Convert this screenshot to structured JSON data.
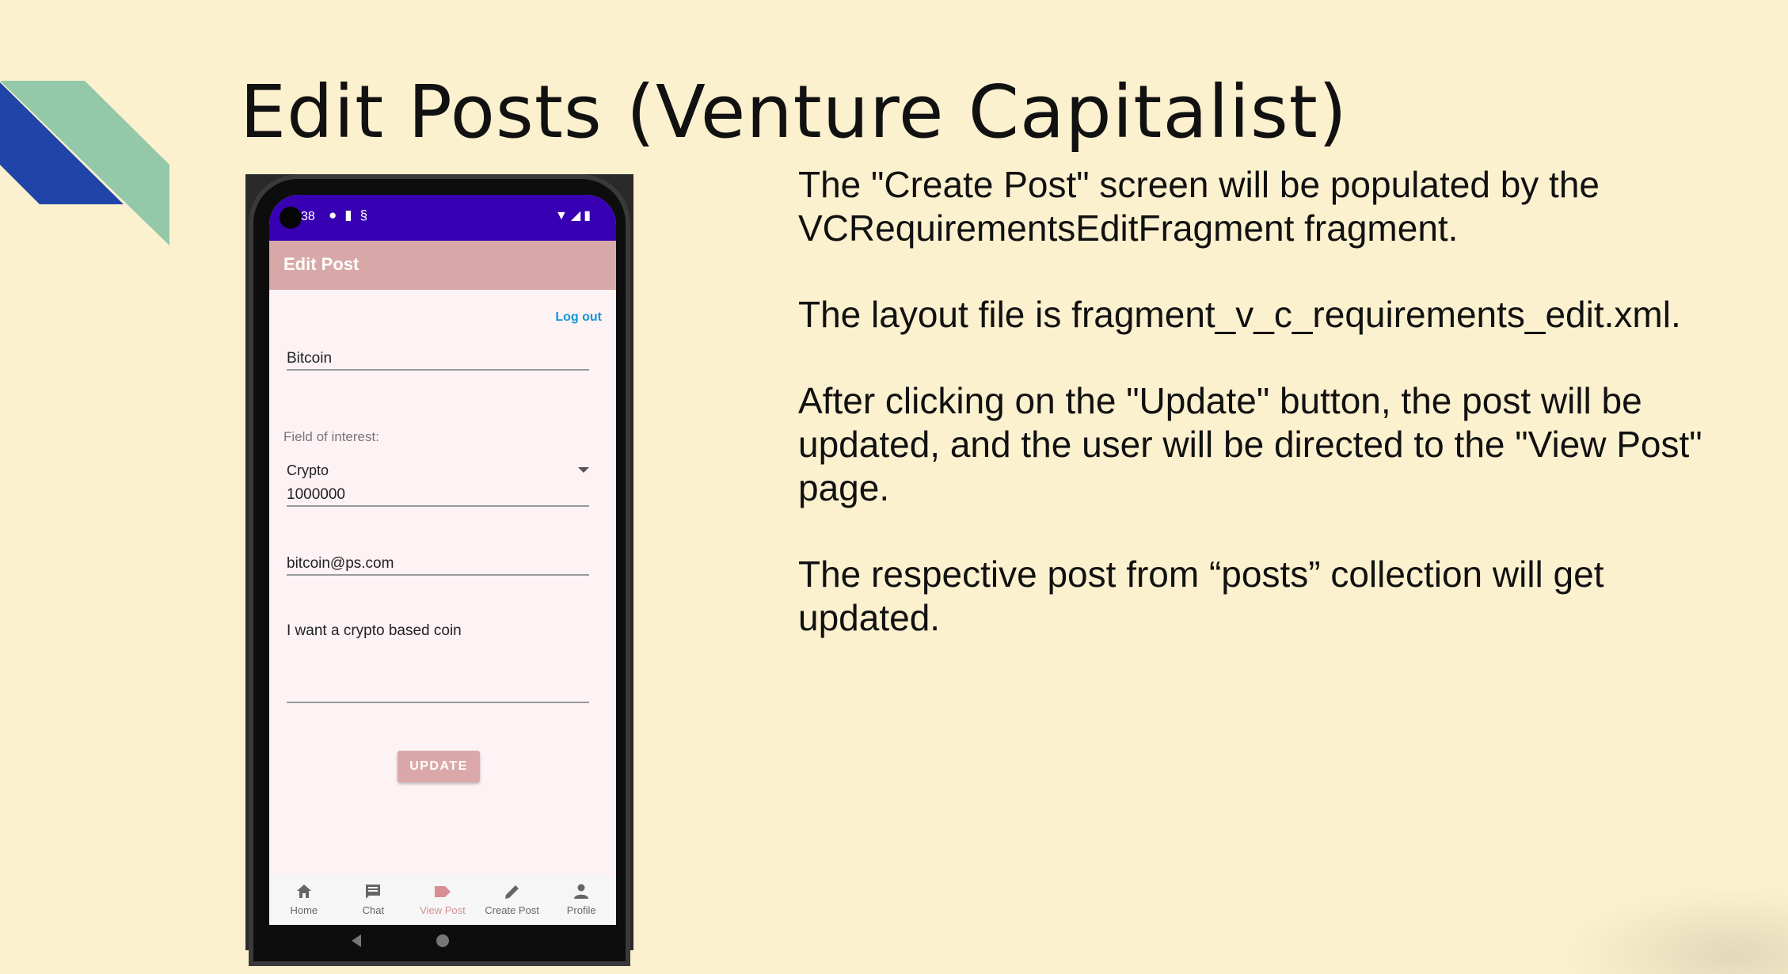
{
  "slide": {
    "title": "Edit Posts (Venture Capitalist)",
    "paragraphs": [
      "The \"Create Post\" screen will be populated by the VCRequirementsEditFragment fragment.",
      "The layout file is fragment_v_c_requirements_edit.xml.",
      "After clicking on the \"Update\" button, the post will be updated, and the user will be directed to the \"View Post\" page.",
      "The respective post from “posts” collection will get updated."
    ],
    "colors": {
      "background": "#fcf1cf",
      "accent_blue": "#1f45a8",
      "accent_green": "#93c9a8"
    }
  },
  "phone": {
    "status_bar": {
      "time": "38",
      "color": "#3800b3"
    },
    "app_bar": {
      "title": "Edit Post",
      "color": "#d8a8a9"
    },
    "logout_label": "Log out",
    "fields": {
      "title_value": "Bitcoin",
      "interest_label": "Field of interest:",
      "interest_selected": "Crypto",
      "amount_value": "1000000",
      "email_value": "bitcoin@ps.com",
      "description_value": "I want a crypto based coin"
    },
    "update_button": "UPDATE",
    "bottom_nav": [
      {
        "label": "Home",
        "icon": "home-icon"
      },
      {
        "label": "Chat",
        "icon": "chat-icon"
      },
      {
        "label": "View Post",
        "icon": "label-icon",
        "active": true
      },
      {
        "label": "Create Post",
        "icon": "pencil-icon"
      },
      {
        "label": "Profile",
        "icon": "person-icon"
      }
    ]
  }
}
